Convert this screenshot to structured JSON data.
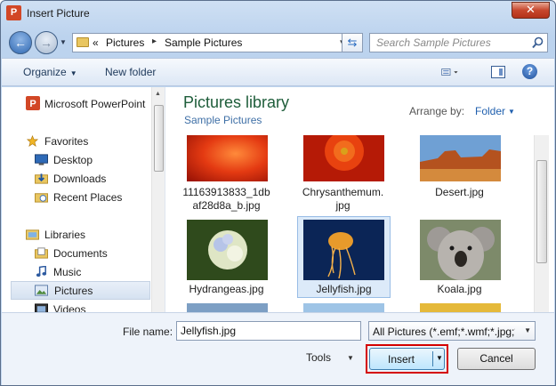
{
  "window": {
    "title": "Insert Picture",
    "app_icon_letter": "P",
    "close_glyph": "✕"
  },
  "address": {
    "overflow": "«",
    "segments": [
      "Pictures",
      "Sample Pictures"
    ],
    "separator": "▸"
  },
  "search": {
    "placeholder": "Search Sample Pictures"
  },
  "toolbar": {
    "organize": "Organize",
    "new_folder": "New folder",
    "help": "?"
  },
  "nav": {
    "items": [
      {
        "label": "Microsoft PowerPoint",
        "icon": "powerpoint-icon"
      },
      {
        "label": "Favorites",
        "icon": "star-icon"
      },
      {
        "label": "Desktop",
        "icon": "desktop-icon"
      },
      {
        "label": "Downloads",
        "icon": "downloads-icon"
      },
      {
        "label": "Recent Places",
        "icon": "recent-places-icon"
      },
      {
        "label": "Libraries",
        "icon": "libraries-icon"
      },
      {
        "label": "Documents",
        "icon": "documents-icon"
      },
      {
        "label": "Music",
        "icon": "music-icon"
      },
      {
        "label": "Pictures",
        "icon": "pictures-icon",
        "selected": true
      },
      {
        "label": "Videos",
        "icon": "videos-icon"
      }
    ]
  },
  "library": {
    "title": "Pictures library",
    "subtitle": "Sample Pictures",
    "arrange_label": "Arrange by:",
    "arrange_value": "Folder"
  },
  "files": [
    {
      "line1": "11163913833_1db",
      "line2": "af28d8a_b.jpg"
    },
    {
      "line1": "Chrysanthemum.",
      "line2": "jpg"
    },
    {
      "line1": "Desert.jpg",
      "line2": ""
    },
    {
      "line1": "Hydrangeas.jpg",
      "line2": ""
    },
    {
      "line1": "Jellyfish.jpg",
      "line2": "",
      "selected": true
    },
    {
      "line1": "Koala.jpg",
      "line2": ""
    }
  ],
  "bottom": {
    "file_name_label": "File name:",
    "file_name_value": "Jellyfish.jpg",
    "file_type": "All Pictures (*.emf;*.wmf;*.jpg;*",
    "tools": "Tools",
    "insert": "Insert",
    "cancel": "Cancel"
  },
  "colors": {
    "library_title": "#1e5d3a",
    "link_blue": "#1f5fae",
    "selection": "#dceaf9",
    "highlight_red": "#d40000"
  }
}
